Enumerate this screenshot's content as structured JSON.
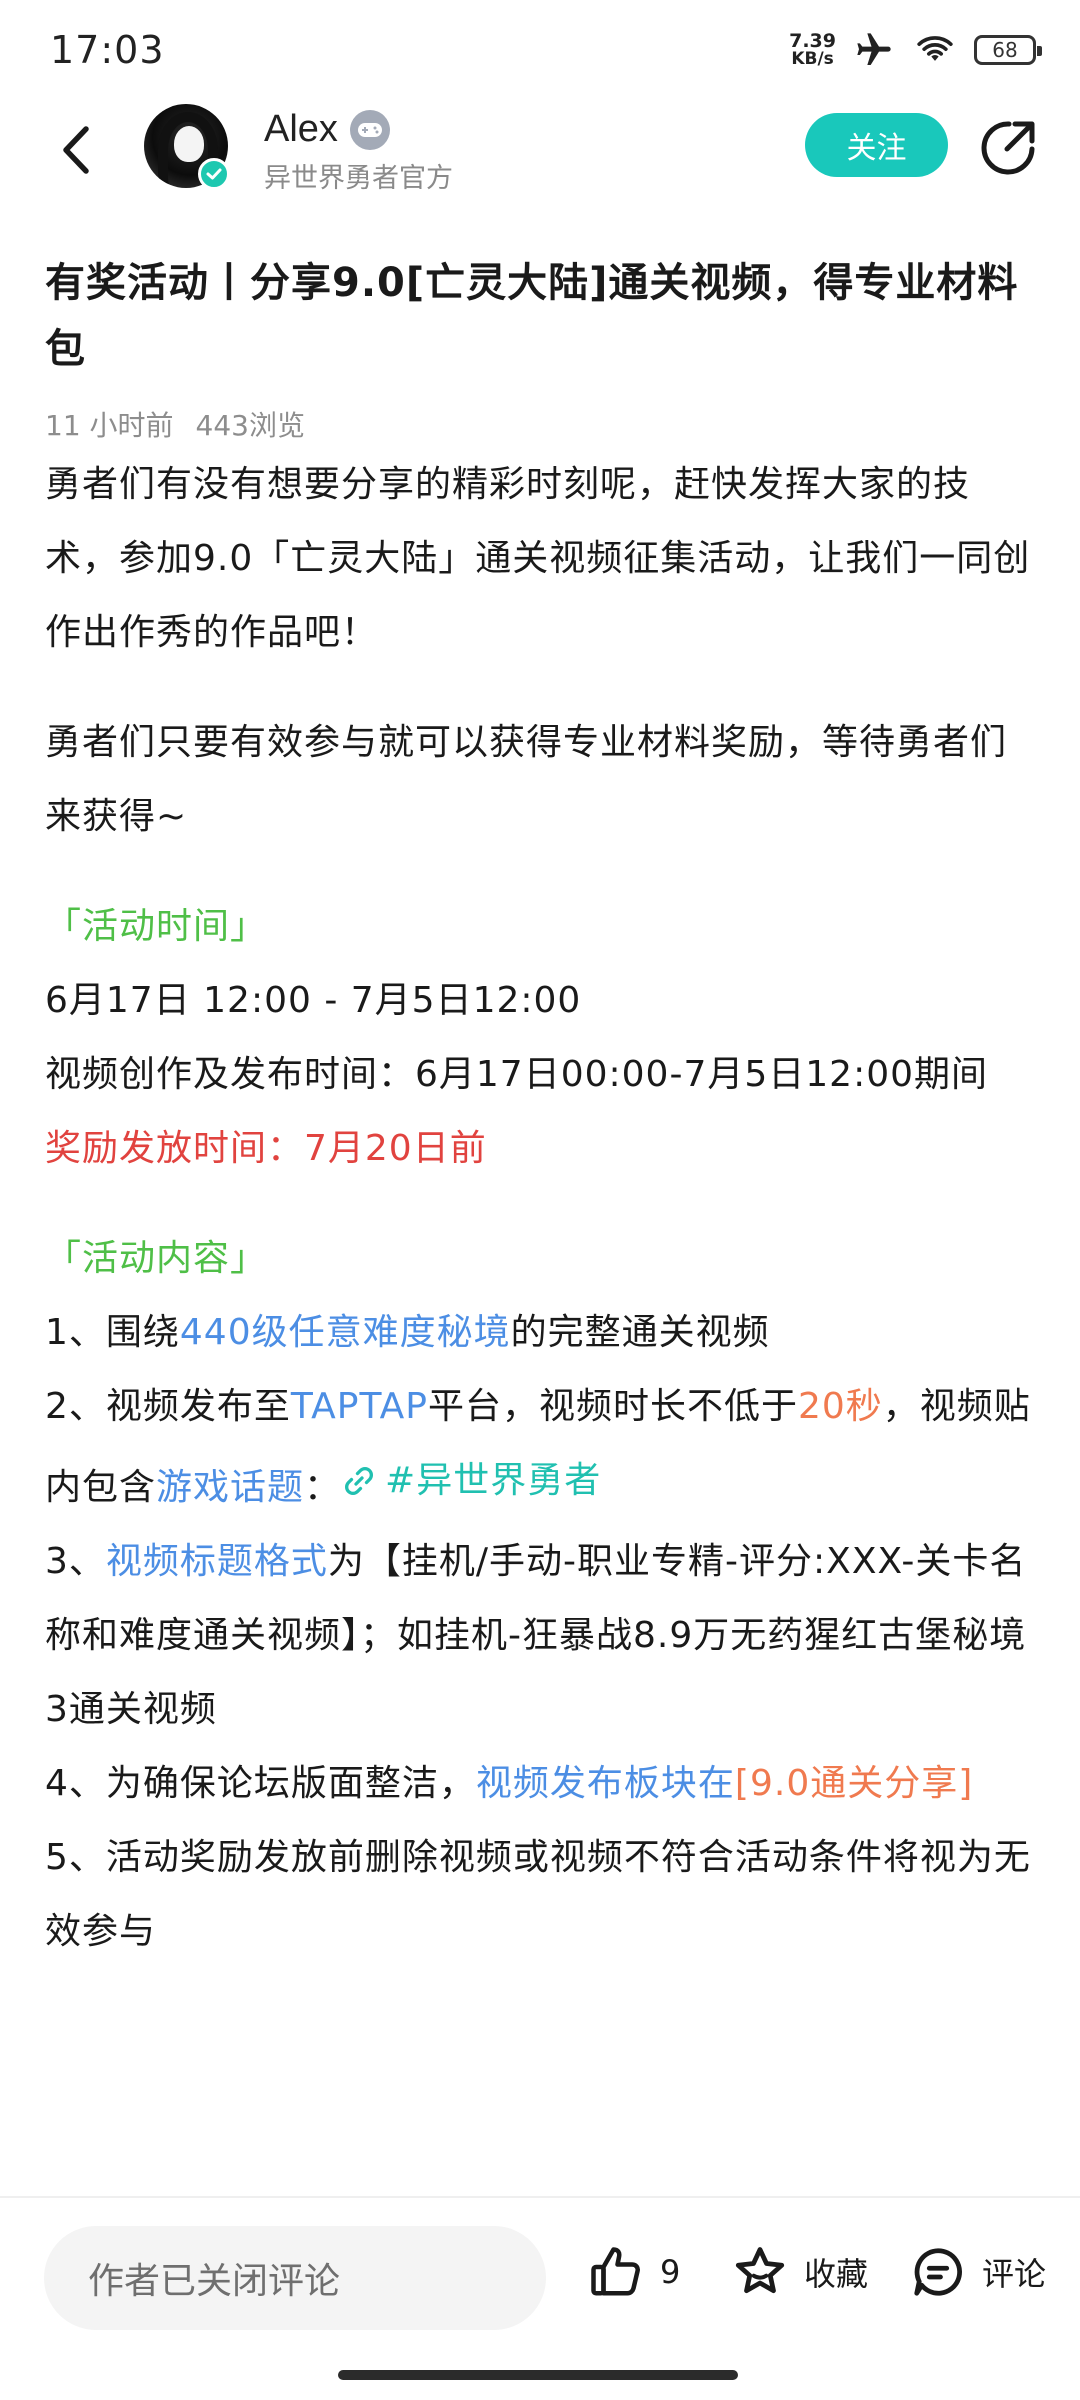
{
  "status_bar": {
    "time": "17:03",
    "net_speed_value": "7.39",
    "net_speed_unit": "KB/s",
    "battery": "68"
  },
  "header": {
    "user_name": "Alex",
    "user_subtitle": "异世界勇者官方",
    "follow_label": "关注"
  },
  "post": {
    "title": "有奖活动丨分享9.0[亡灵大陆]通关视频，得专业材料包",
    "time_ago": "11 小时前",
    "views": "443浏览",
    "intro_1": "勇者们有没有想要分享的精彩时刻呢，赶快发挥大家的技术，参加9.0「亡灵大陆」通关视频征集活动，让我们一同创作出作秀的作品吧！",
    "intro_2": "勇者们只要有效参与就可以获得专业材料奖励，等待勇者们来获得~",
    "section_time_heading": "「活动时间」",
    "time_range": "6月17日 12:00 - 7月5日12:00",
    "create_time": "视频创作及发布时间：6月17日00:00-7月5日12:00期间",
    "reward_time": "奖励发放时间：7月20日前",
    "section_content_heading": "「活动内容」",
    "rule1_prefix": "1、围绕",
    "rule1_highlight": "440级任意难度秘境",
    "rule1_suffix": "的完整通关视频",
    "rule2_prefix": "2、视频发布至",
    "rule2_platform": "TAPTAP",
    "rule2_mid": "平台，视频时长不低于",
    "rule2_duration": "20秒",
    "rule2_mid2": "，视频贴内包含",
    "rule2_topic_label": "游戏话题",
    "rule2_colon": "：",
    "rule2_topic": "#异世界勇者",
    "rule3_prefix": "3、",
    "rule3_highlight": "视频标题格式",
    "rule3_suffix": "为【挂机/手动-职业专精-评分:XXX-关卡名称和难度通关视频】；如挂机-狂暴战8.9万无药猩红古堡秘境3通关视频",
    "rule4_prefix": "4、为确保论坛版面整洁，",
    "rule4_highlight": "视频发布板块在",
    "rule4_board": "[9.0通关分享]",
    "rule5": "5、活动奖励发放前删除视频或视频不符合活动条件将视为无效参与"
  },
  "bottom_bar": {
    "comment_placeholder": "作者已关闭评论",
    "like_count": "9",
    "favorite_label": "收藏",
    "comment_label": "评论"
  },
  "colors": {
    "accent": "#19c8bb",
    "heading_green": "#4fbf47",
    "alert_red": "#e1433f",
    "link_blue": "#4c8ee4",
    "highlight_orange": "#f07a4f"
  },
  "icons": [
    "back-arrow-icon",
    "verified-icon",
    "gamepad-badge-icon",
    "share-icon",
    "link-icon",
    "thumbs-up-icon",
    "star-icon",
    "comment-icon",
    "airplane-icon",
    "wifi-icon",
    "battery-icon"
  ]
}
